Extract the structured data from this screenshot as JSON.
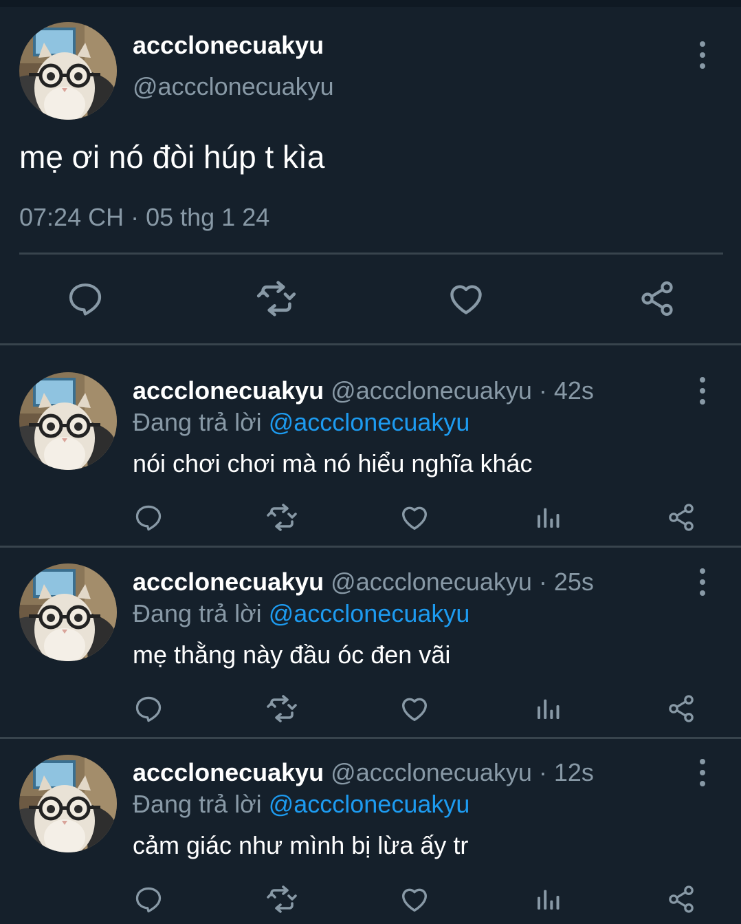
{
  "main_tweet": {
    "display_name": "accclonecuakyu",
    "handle": "@accclonecuakyu",
    "text": "mẹ ơi nó đòi húp t kìa",
    "timestamp": "07:24 CH · 05 thg 1 24",
    "actions": [
      "reply-icon",
      "retweet-icon",
      "like-icon",
      "share-icon"
    ]
  },
  "replies": [
    {
      "display_name": "accclonecuakyu",
      "handle": "@accclonecuakyu",
      "time": "· 42s",
      "replying_prefix": "Đang trả lời",
      "replying_to": "@accclonecuakyu",
      "text": "nói chơi chơi mà nó hiểu nghĩa khác"
    },
    {
      "display_name": "accclonecuakyu",
      "handle": "@accclonecuakyu",
      "time": "· 25s",
      "replying_prefix": "Đang trả lời",
      "replying_to": "@accclonecuakyu",
      "text": "mẹ thằng này đầu óc đen vãi"
    },
    {
      "display_name": "accclonecuakyu",
      "handle": "@accclonecuakyu",
      "time": "· 12s",
      "replying_prefix": "Đang trả lời",
      "replying_to": "@accclonecuakyu",
      "text": "cảm giác như mình bị lừa ấy tr"
    }
  ],
  "reply_actions": [
    "reply-icon",
    "retweet-icon",
    "like-icon",
    "analytics-icon",
    "share-icon"
  ],
  "colors": {
    "background": "#15202b",
    "divider": "#38444d",
    "secondary_text": "#8899a6",
    "mention": "#1d9bf0",
    "icon": "#8899a6"
  }
}
